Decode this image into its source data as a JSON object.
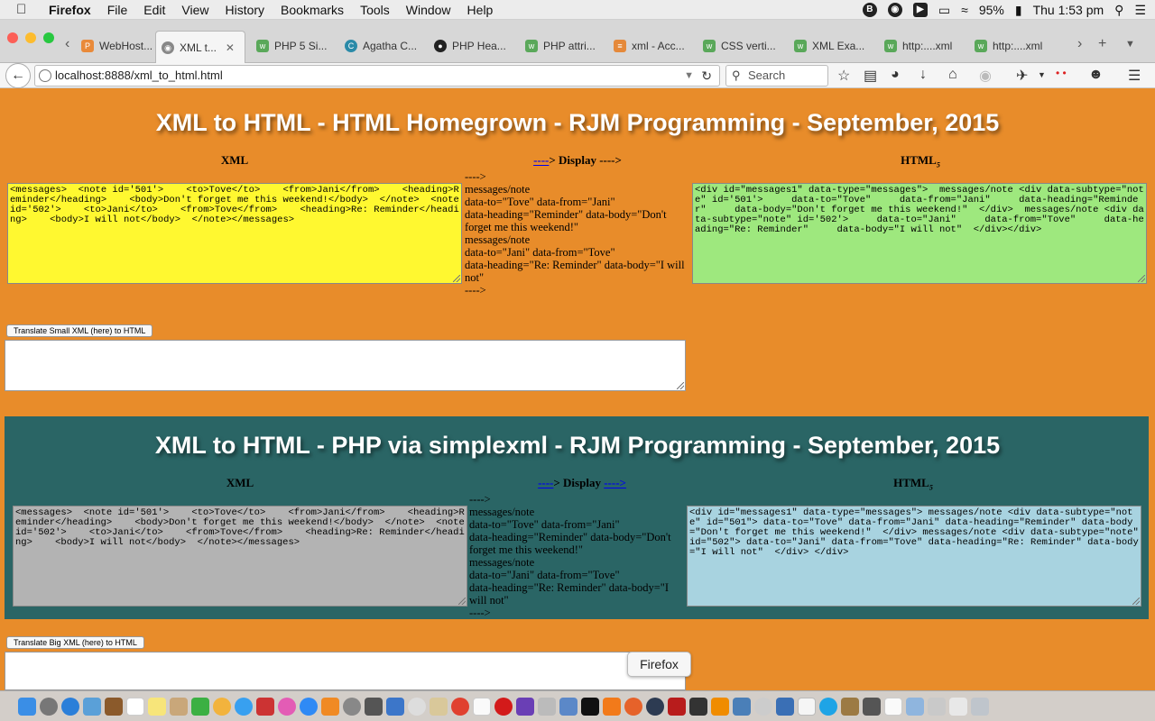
{
  "menubar": {
    "items": [
      "Firefox",
      "File",
      "Edit",
      "View",
      "History",
      "Bookmarks",
      "Tools",
      "Window",
      "Help"
    ],
    "battery": "95%",
    "clock": "Thu 1:53 pm"
  },
  "tabs": [
    {
      "label": "WebHost...",
      "icon": "webhost-icon"
    },
    {
      "label": "XML t...",
      "icon": "globe-icon",
      "active": true
    },
    {
      "label": "PHP 5 Si...",
      "icon": "w3schools-icon"
    },
    {
      "label": "Agatha C...",
      "icon": "agatha-icon"
    },
    {
      "label": "PHP Hea...",
      "icon": "github-icon"
    },
    {
      "label": "PHP attri...",
      "icon": "w3schools-icon"
    },
    {
      "label": "xml - Acc...",
      "icon": "stackoverflow-icon"
    },
    {
      "label": "CSS verti...",
      "icon": "w3schools-icon"
    },
    {
      "label": "XML Exa...",
      "icon": "w3schools-icon"
    },
    {
      "label": "http:....xml",
      "icon": "w3schools-icon"
    },
    {
      "label": "http:....xml",
      "icon": "w3schools-icon"
    }
  ],
  "navbar": {
    "url": "localhost:8888/xml_to_html.html",
    "search_placeholder": "Search"
  },
  "section1": {
    "title": "XML to HTML - HTML Homegrown - RJM Programming - September, 2015",
    "col_xml": "XML",
    "col_display_link": "----",
    "col_display_text": "> Display ---->",
    "col_html": "HTML",
    "col_html_sub": "5",
    "xml_text": "<messages>  <note id='501'>    <to>Tove</to>    <from>Jani</from>    <heading>Reminder</heading>    <body>Don't forget me this weekend!</body>  </note>  <note id='502'>    <to>Jani</to>    <from>Tove</from>    <heading>Re: Reminder</heading>    <body>I will not</body>  </note></messages>",
    "display_lines": [
      "---->",
      "messages/note",
      "data-to=\"Tove\" data-from=\"Jani\"",
      "data-heading=\"Reminder\" data-body=\"Don't forget me this weekend!\"",
      "messages/note",
      "data-to=\"Jani\" data-from=\"Tove\"",
      "data-heading=\"Re: Reminder\" data-body=\"I will not\"",
      "---->"
    ],
    "html_text": "<div id=\"messages1\" data-type=\"messages\">  messages/note <div data-subtype=\"note\" id='501'>     data-to=\"Tove\"     data-from=\"Jani\"     data-heading=\"Reminder\"     data-body=\"Don't forget me this weekend!\"  </div>  messages/note <div data-subtype=\"note\" id='502'>     data-to=\"Jani\"     data-from=\"Tove\"     data-heading=\"Re: Reminder\"     data-body=\"I will not\"  </div></div>",
    "button": "Translate Small XML (here) to HTML"
  },
  "section2": {
    "title": "XML to HTML - PHP via simplexml - RJM Programming - September, 2015",
    "col_xml": "XML",
    "col_display_link1": "----",
    "col_display_text": "> Display ",
    "col_display_link2": "---->",
    "col_html": "HTML",
    "col_html_sub": "5",
    "xml_text": "<messages>  <note id='501'>    <to>Tove</to>    <from>Jani</from>    <heading>Reminder</heading>    <body>Don't forget me this weekend!</body>  </note>  <note id='502'>    <to>Jani</to>    <from>Tove</from>    <heading>Re: Reminder</heading>    <body>I will not</body>  </note></messages>",
    "display_lines": [
      "---->",
      "messages/note",
      "data-to=\"Tove\" data-from=\"Jani\"",
      "data-heading=\"Reminder\" data-body=\"Don't forget me this weekend!\"",
      "messages/note",
      "data-to=\"Jani\" data-from=\"Tove\"",
      "data-heading=\"Re: Reminder\" data-body=\"I will not\"",
      "---->"
    ],
    "html_text": "<div id=\"messages1\" data-type=\"messages\"> messages/note <div data-subtype=\"note\" id=\"501\"> data-to=\"Tove\" data-from=\"Jani\" data-heading=\"Reminder\" data-body=\"Don't forget me this weekend!\"  </div> messages/note <div data-subtype=\"note\" id=\"502\"> data-to=\"Jani\" data-from=\"Tove\" data-heading=\"Re: Reminder\" data-body=\"I will not\"  </div> </div>",
    "button": "Translate Big XML (here) to HTML"
  },
  "tooltip": "Firefox",
  "colors": {
    "page_bg": "#e88c2a",
    "section2_bg": "#2a6565",
    "xml1_bg": "#fff830",
    "html1_bg": "#9ee87e",
    "xml2_bg": "#b3b3b3",
    "html2_bg": "#a8d3e0"
  }
}
